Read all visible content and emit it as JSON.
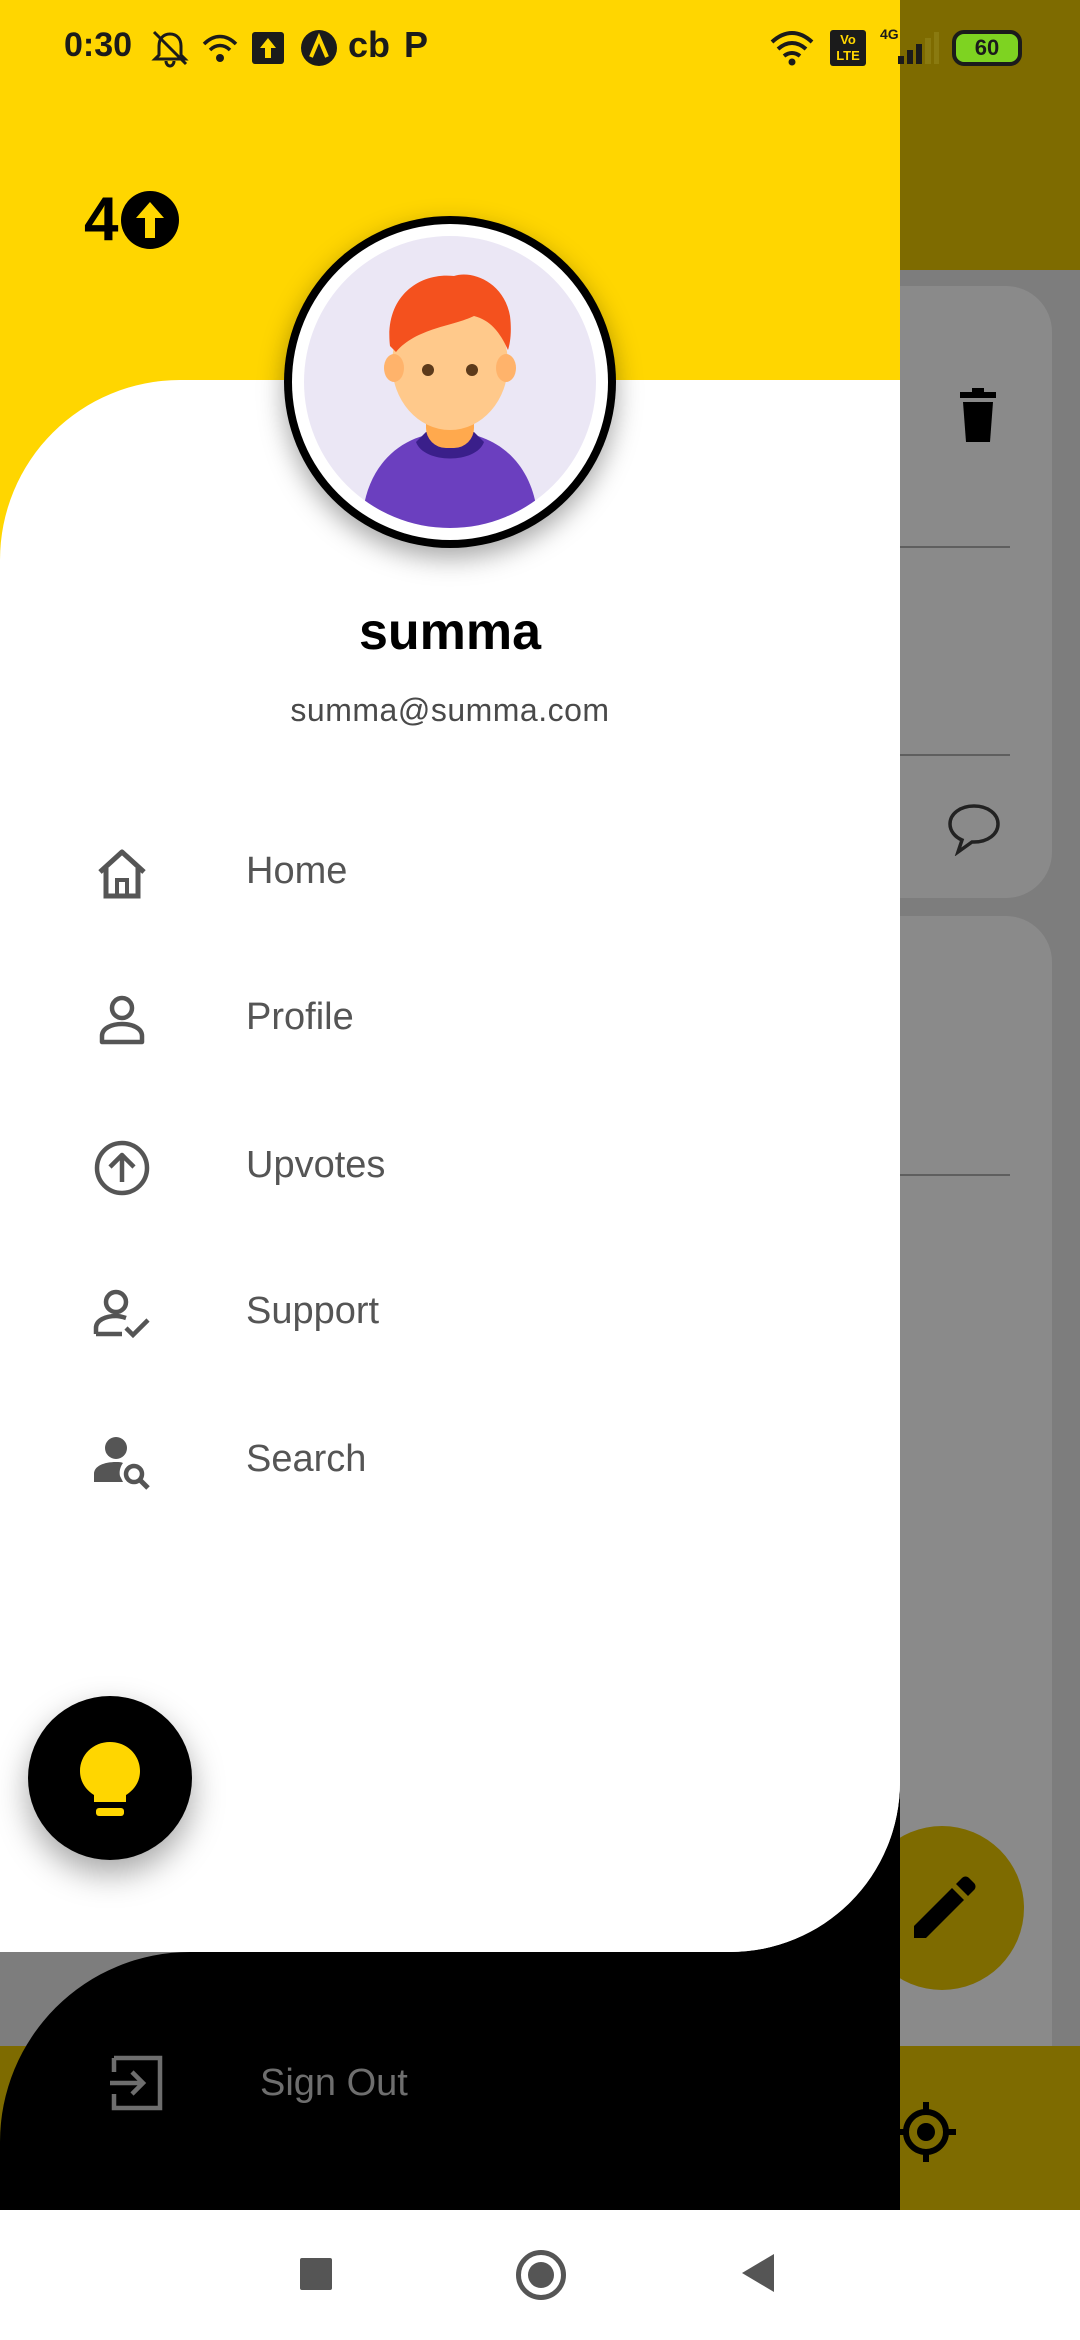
{
  "status_bar": {
    "time": "0:30",
    "battery": "60",
    "network": "4G",
    "volte": "VoLTE"
  },
  "logo": {
    "number": "4"
  },
  "user": {
    "name": "summa",
    "email": "summa@summa.com"
  },
  "menu": {
    "items": [
      {
        "label": "Home",
        "icon": "home-icon"
      },
      {
        "label": "Profile",
        "icon": "person-icon"
      },
      {
        "label": "Upvotes",
        "icon": "arrow-up-circle-icon"
      },
      {
        "label": "Support",
        "icon": "person-check-icon"
      },
      {
        "label": "Search",
        "icon": "person-search-icon"
      }
    ]
  },
  "sign_out": {
    "label": "Sign Out",
    "icon": "exit-icon"
  },
  "colors": {
    "accent_yellow": "#ffd600",
    "drawer_black": "#000000",
    "menu_text": "#555555"
  }
}
